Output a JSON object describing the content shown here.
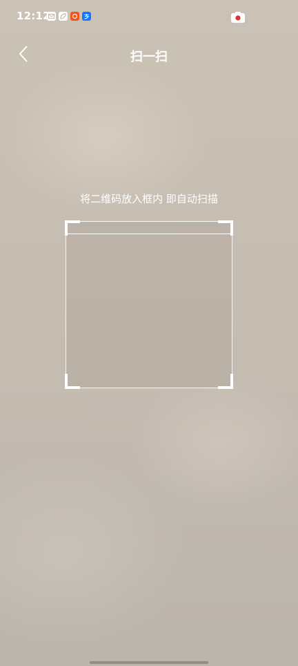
{
  "status_bar": {
    "time": "12:12",
    "notifications": [
      {
        "icon": "mail-icon"
      },
      {
        "icon": "leaf-icon"
      },
      {
        "icon": "taobao-icon",
        "color": "#f0541e"
      },
      {
        "icon": "alipay-icon",
        "color": "#1677ff"
      }
    ],
    "camera_indicator": {
      "icon": "camera-icon",
      "dot_color": "#e0312c"
    }
  },
  "header": {
    "back_icon": "chevron-left-icon",
    "title": "扫一扫"
  },
  "scanner": {
    "hint": "将二维码放入框内 即自动扫描"
  }
}
